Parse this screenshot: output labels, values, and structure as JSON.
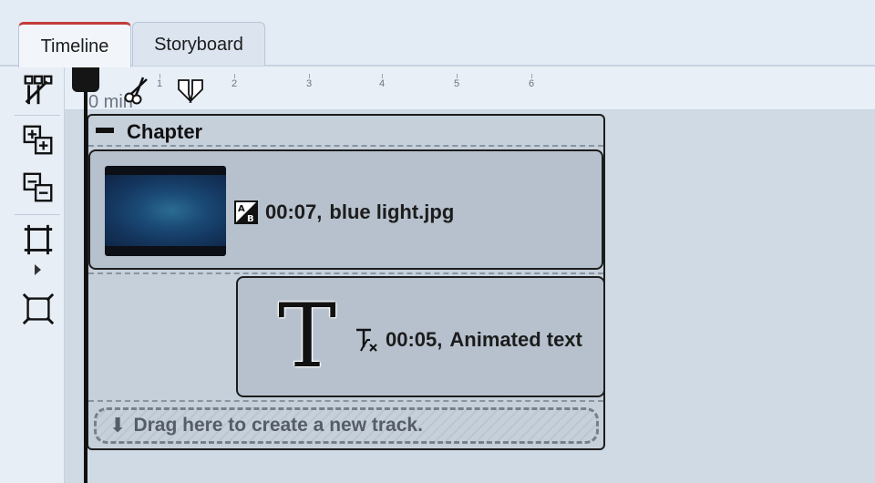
{
  "tabs": [
    {
      "label": "Timeline",
      "active": true
    },
    {
      "label": "Storyboard",
      "active": false
    }
  ],
  "ruler": {
    "unit": "0 min",
    "ticks": [
      "1",
      "2",
      "3",
      "4",
      "5",
      "6"
    ]
  },
  "toolbar": {
    "icons": [
      "grid-split-icon",
      "add-track-icon",
      "remove-track-icon",
      "fit-frame-icon",
      "expand-frame-icon"
    ]
  },
  "chapter": {
    "title": "Chapter"
  },
  "clips": [
    {
      "duration": "00:07,",
      "name": "blue light.jpg",
      "icon": "image-transition-icon"
    },
    {
      "duration": "00:05,",
      "name": "Animated text",
      "thumb_glyph": "T",
      "icon": "text-effect-icon"
    }
  ],
  "dropzone": {
    "label": "Drag here to create a new track.",
    "arrow": "⬇"
  },
  "colors": {
    "active_tab_accent": "#c23b3b",
    "clip_background": "#b6c1cd",
    "timeline_background": "#d0dae5"
  }
}
